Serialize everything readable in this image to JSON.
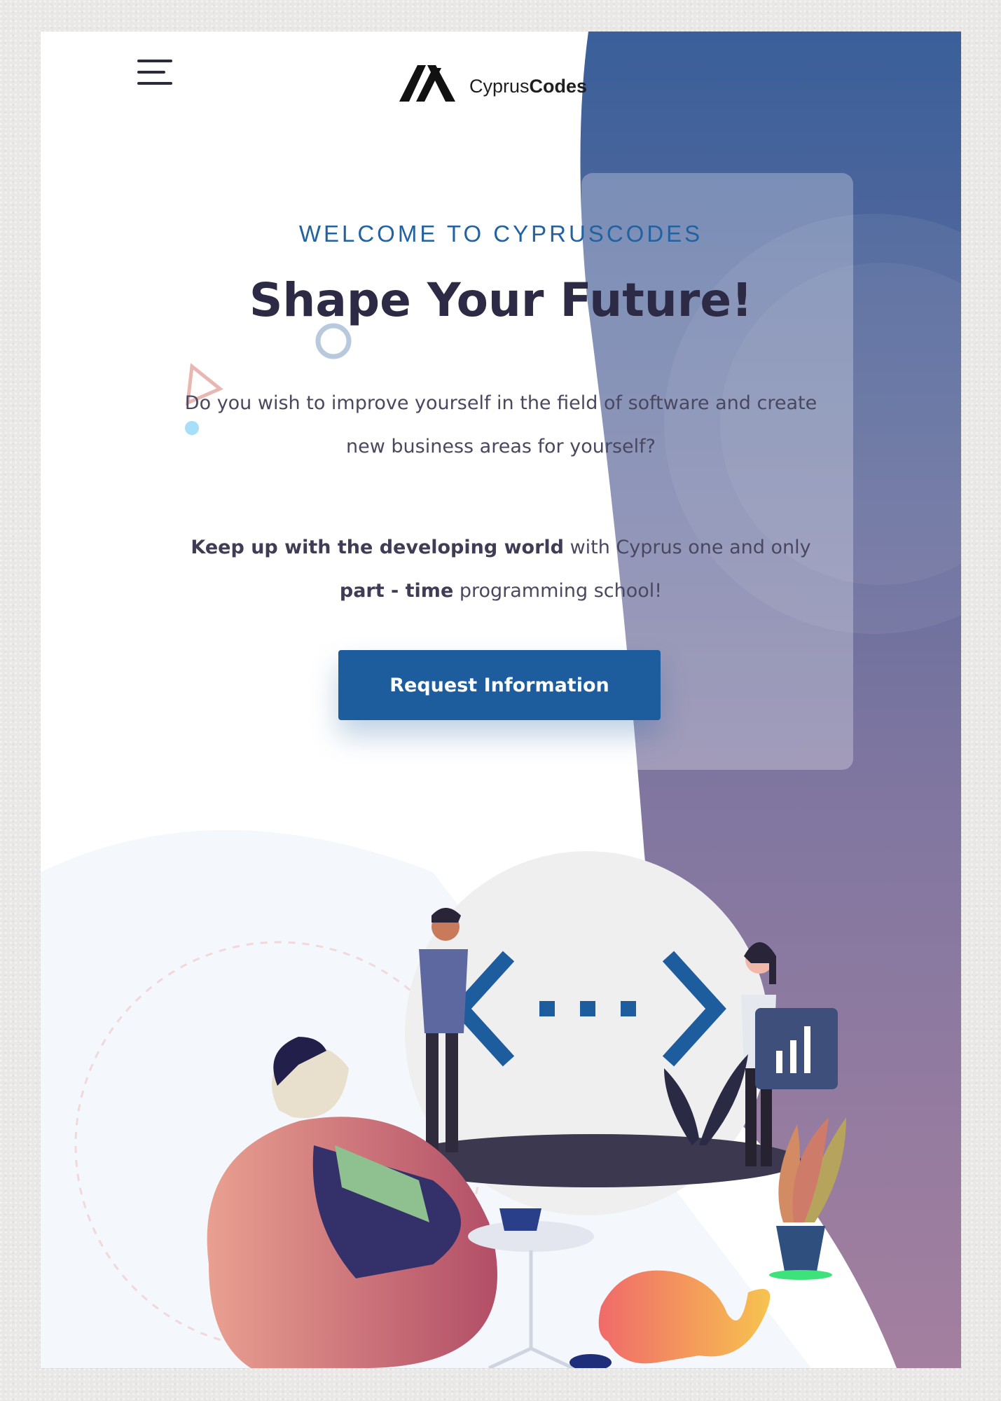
{
  "logo": {
    "brand_light": "Cyprus",
    "brand_bold": "Codes"
  },
  "nav": {
    "menu_icon": "hamburger-menu-icon"
  },
  "hero": {
    "kicker": "WELCOME TO CYPRUSCODES",
    "title": "Shape Your Future!",
    "intro": "Do you wish to improve yourself in the field of software and create new business areas for yourself?",
    "tagline_bold_1": "Keep up with the developing world",
    "tagline_mid": " with Cyprus one and only ",
    "tagline_bold_2": "part - time",
    "tagline_end": " programming school!",
    "cta_label": "Request Information"
  },
  "colors": {
    "accent": "#1e5d9d",
    "title": "#2d2a45",
    "gradient_top": "#3a5f9a",
    "gradient_bottom": "#a47f9f"
  },
  "illustration": {
    "chart_icon": "bar-chart-icon",
    "code_icon": "code-brackets-icon"
  }
}
